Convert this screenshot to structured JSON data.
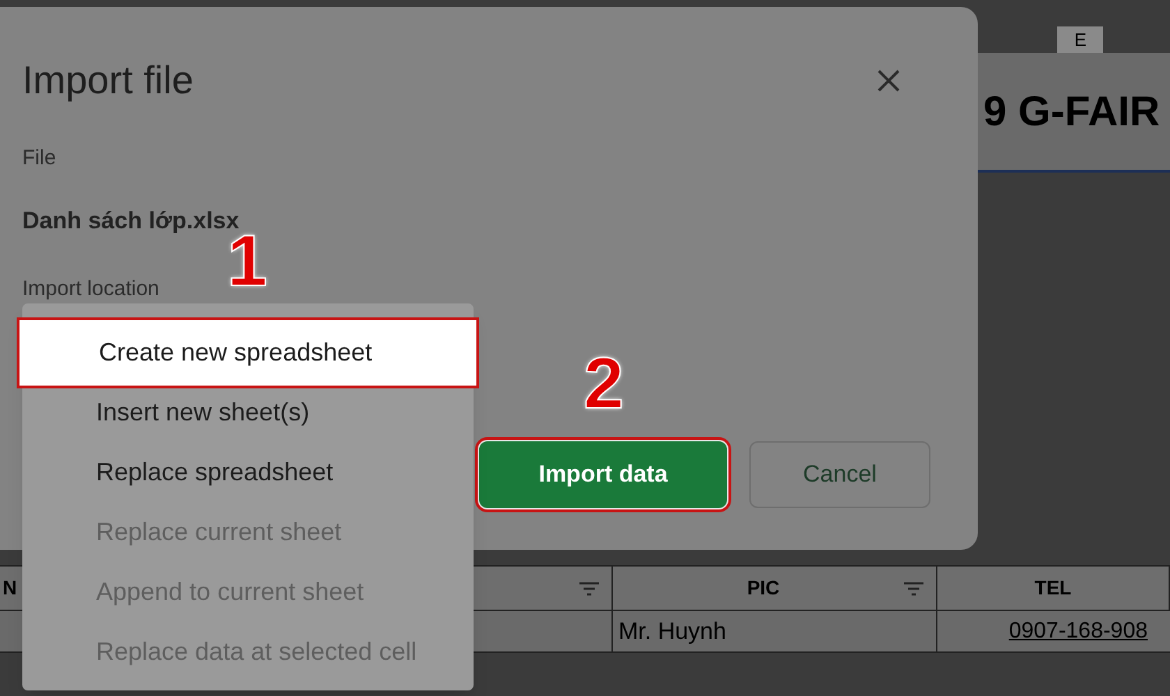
{
  "spreadsheet": {
    "column_header": "E",
    "title": "9 G-FAIR",
    "table": {
      "columns": [
        {
          "label": "N",
          "filter": true
        },
        {
          "label": "PIC",
          "filter": true
        },
        {
          "label": "TEL",
          "filter": false
        }
      ],
      "rows": [
        {
          "pic": "Mr. Huynh",
          "tel": "0907-168-908"
        }
      ]
    }
  },
  "dialog": {
    "title": "Import file",
    "file_label": "File",
    "file_name": "Danh sách lớp.xlsx",
    "location_label": "Import location",
    "location_options": [
      {
        "label": "Create new spreadsheet",
        "selected": true,
        "disabled": false
      },
      {
        "label": "Insert new sheet(s)",
        "selected": false,
        "disabled": false
      },
      {
        "label": "Replace spreadsheet",
        "selected": false,
        "disabled": false
      },
      {
        "label": "Replace current sheet",
        "selected": false,
        "disabled": true
      },
      {
        "label": "Append to current sheet",
        "selected": false,
        "disabled": true
      },
      {
        "label": "Replace data at selected cell",
        "selected": false,
        "disabled": true
      }
    ],
    "buttons": [
      {
        "label": "Import data",
        "kind": "primary"
      },
      {
        "label": "Cancel",
        "kind": "secondary"
      }
    ]
  },
  "annotations": [
    "1",
    "2"
  ]
}
